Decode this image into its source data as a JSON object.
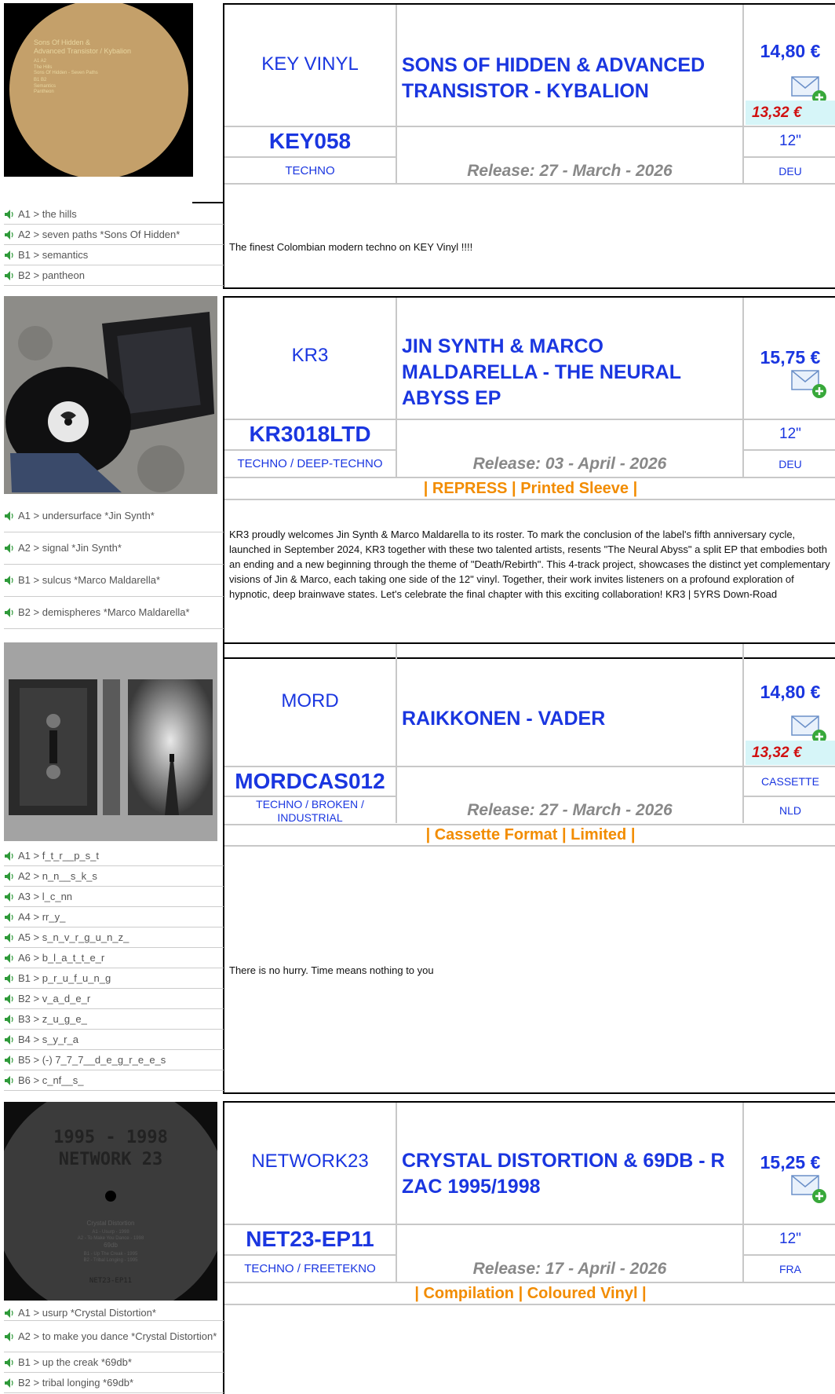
{
  "colors": {
    "link": "#1a36e0",
    "discount": "#d01010",
    "notes": "#f28c00",
    "release": "#888888"
  },
  "icons": {
    "play": "speaker-icon",
    "wishlist": "envelope-add-icon"
  },
  "releases": [
    {
      "label": "KEY VINYL",
      "title": "SONS OF HIDDEN & ADVANCED TRANSISTOR - KYBALION",
      "price": "14,80 €",
      "discount": "13,32 €",
      "catalog": "KEY058",
      "format": "12\"",
      "genre": "TECHNO",
      "release": "Release: 27 - March - 2026",
      "country": "DEU",
      "notes": "",
      "description": "The finest Colombian modern techno on KEY Vinyl !!!!",
      "cover_text": [
        "Sons Of Hidden &",
        "Advanced Transistor / Kybalion",
        "A1 A2",
        "The Hills",
        "Sons Of Hidden - Seven Paths",
        "B1 B2",
        "Semantics",
        "Pantheon"
      ],
      "tracks": [
        "A1 > the hills",
        "A2 > seven paths *Sons Of Hidden*",
        "B1 > semantics",
        "B2 > pantheon"
      ]
    },
    {
      "label": "KR3",
      "title": "JIN SYNTH & MARCO MALDARELLA - THE NEURAL ABYSS EP",
      "price": "15,75 €",
      "discount": "",
      "catalog": "KR3018LTD",
      "format": "12\"",
      "genre": "TECHNO / DEEP-TECHNO",
      "release": "Release: 03 - April - 2026",
      "country": "DEU",
      "notes": "| REPRESS | Printed Sleeve |",
      "description": "KR3 proudly welcomes Jin Synth & Marco Maldarella to its roster. To mark the conclusion of the label's fifth anniversary cycle, launched in September 2024, KR3 together with these two talented artists, resents \"The Neural Abyss\" a split EP that embodies both an ending and a new beginning through the theme of \"Death/Rebirth\". This 4-track project, showcases the distinct yet complementary visions of Jin & Marco, each taking one side of the 12\" vinyl. Together, their work invites listeners on a profound exploration of hypnotic, deep brainwave states. Let's celebrate the final chapter with this exciting collaboration! KR3 | 5YRS Down-Road",
      "cover_text": [],
      "tracks": [
        "A1 > undersurface *Jin Synth*",
        "A2 > signal *Jin Synth*",
        "B1 > sulcus *Marco Maldarella*",
        "B2 > demispheres *Marco Maldarella*"
      ]
    },
    {
      "label": "MORD",
      "title": "RAIKKONEN - VADER",
      "price": "14,80 €",
      "discount": "13,32 €",
      "catalog": "MORDCAS012",
      "format": "CASSETTE",
      "genre": "TECHNO / BROKEN / INDUSTRIAL",
      "release": "Release: 27 - March - 2026",
      "country": "NLD",
      "notes": "| Cassette Format | Limited |",
      "description": "There is no hurry. Time means nothing to you",
      "cover_text": [],
      "tracks": [
        "A1 > f_t_r__p_s_t",
        "A2 > n_n__s_k_s",
        "A3 > l_c_nn",
        "A4 > rr_y_",
        "A5 > s_n_v_r_g_u_n_z_",
        "A6 > b_l_a_t_t_e_r",
        "B1 > p_r_u_f_u_n_g",
        "B2 > v_a_d_e_r",
        "B3 > z_u_g_e_",
        "B4 > s_y_r_a",
        "B5 > (-) 7_7_7__d_e_g_r_e_e_s",
        "B6 > c_nf__s_"
      ]
    },
    {
      "label": "NETWORK23",
      "title": "CRYSTAL DISTORTION & 69DB - R ZAC 1995/1998",
      "price": "15,25 €",
      "discount": "",
      "catalog": "NET23-EP11",
      "format": "12\"",
      "genre": "TECHNO / FREETEKNO",
      "release": "Release: 17 - April - 2026",
      "country": "FRA",
      "notes": "| Compilation | Coloured Vinyl |",
      "description": "",
      "cover_text": [
        "1995 - 1998",
        "NETWORK 23",
        "Crystal Distortion",
        "A1 - Usurp - 1998",
        "A2 - To Make You Dance - 1998",
        "69db",
        "B1 - Up The Creak - 1995",
        "B2 - Tribal Longing - 1995",
        "NET23-EP11"
      ],
      "tracks": [
        "A1 > usurp *Crystal Distortion*",
        "A2 > to make you dance *Crystal Distortion*",
        "B1 > up the creak *69db*",
        "B2 > tribal longing *69db*"
      ]
    }
  ]
}
